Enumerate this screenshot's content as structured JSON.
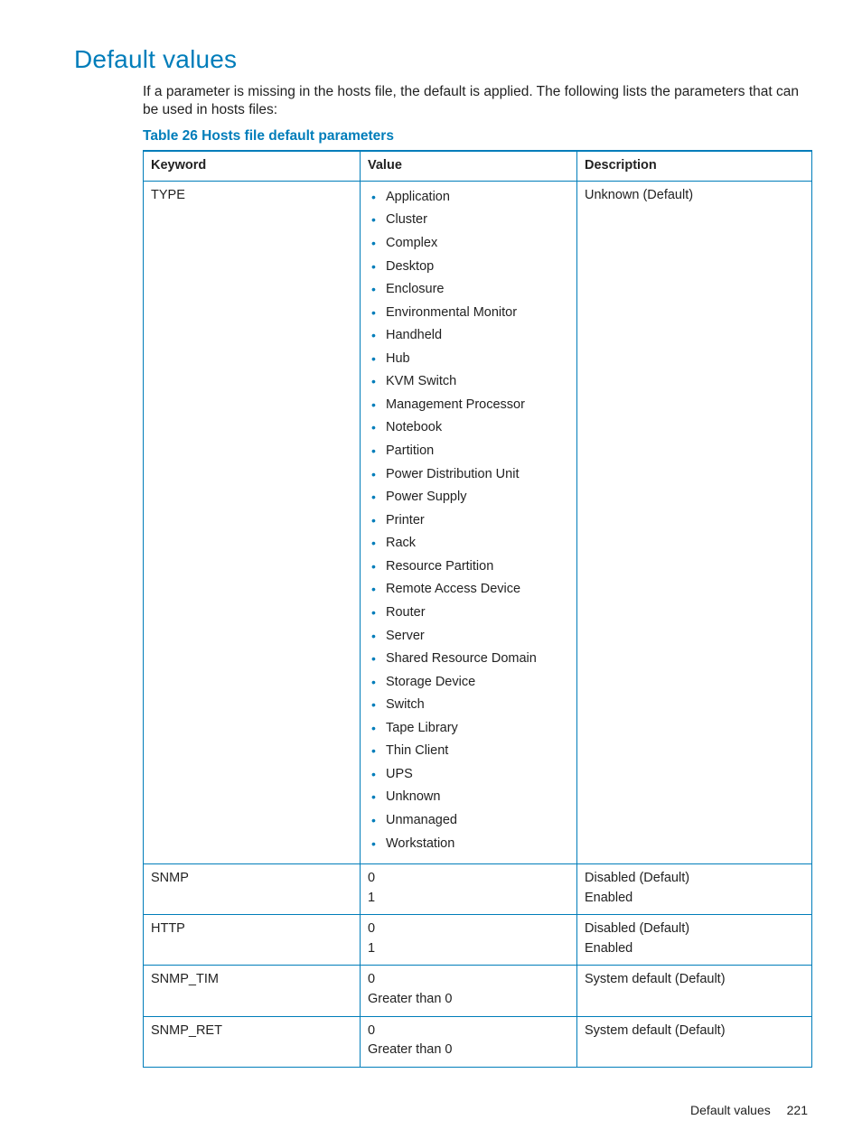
{
  "section_title": "Default values",
  "intro": "If a parameter is missing in the hosts file, the default is applied. The following lists the parameters that can be used in hosts files:",
  "table_caption": "Table 26 Hosts file default parameters",
  "columns": {
    "keyword": "Keyword",
    "value": "Value",
    "description": "Description"
  },
  "rows": {
    "type": {
      "keyword": "TYPE",
      "values": [
        "Application",
        "Cluster",
        "Complex",
        "Desktop",
        "Enclosure",
        "Environmental Monitor",
        "Handheld",
        "Hub",
        "KVM Switch",
        "Management Processor",
        "Notebook",
        "Partition",
        "Power Distribution Unit",
        "Power Supply",
        "Printer",
        "Rack",
        "Resource Partition",
        "Remote Access Device",
        "Router",
        "Server",
        "Shared Resource Domain",
        "Storage Device",
        "Switch",
        "Tape Library",
        "Thin Client",
        "UPS",
        "Unknown",
        "Unmanaged",
        "Workstation"
      ],
      "description": "Unknown (Default)"
    },
    "snmp": {
      "keyword": "SNMP",
      "value_lines": [
        "0",
        "1"
      ],
      "desc_lines": [
        "Disabled (Default)",
        "Enabled"
      ]
    },
    "http": {
      "keyword": "HTTP",
      "value_lines": [
        "0",
        "1"
      ],
      "desc_lines": [
        "Disabled (Default)",
        "Enabled"
      ]
    },
    "snmp_tim": {
      "keyword": "SNMP_TIM",
      "value_lines": [
        "0",
        "Greater than 0"
      ],
      "desc_lines": [
        "System default (Default)"
      ]
    },
    "snmp_ret": {
      "keyword": "SNMP_RET",
      "value_lines": [
        "0",
        "Greater than 0"
      ],
      "desc_lines": [
        "System default (Default)"
      ]
    }
  },
  "footer": {
    "title": "Default values",
    "page": "221"
  },
  "chart_data": {
    "type": "table",
    "title": "Table 26 Hosts file default parameters",
    "columns": [
      "Keyword",
      "Value",
      "Description"
    ],
    "rows": [
      [
        "TYPE",
        "Application; Cluster; Complex; Desktop; Enclosure; Environmental Monitor; Handheld; Hub; KVM Switch; Management Processor; Notebook; Partition; Power Distribution Unit; Power Supply; Printer; Rack; Resource Partition; Remote Access Device; Router; Server; Shared Resource Domain; Storage Device; Switch; Tape Library; Thin Client; UPS; Unknown; Unmanaged; Workstation",
        "Unknown (Default)"
      ],
      [
        "SNMP",
        "0 / 1",
        "Disabled (Default) / Enabled"
      ],
      [
        "HTTP",
        "0 / 1",
        "Disabled (Default) / Enabled"
      ],
      [
        "SNMP_TIM",
        "0 / Greater than 0",
        "System default (Default)"
      ],
      [
        "SNMP_RET",
        "0 / Greater than 0",
        "System default (Default)"
      ]
    ]
  }
}
